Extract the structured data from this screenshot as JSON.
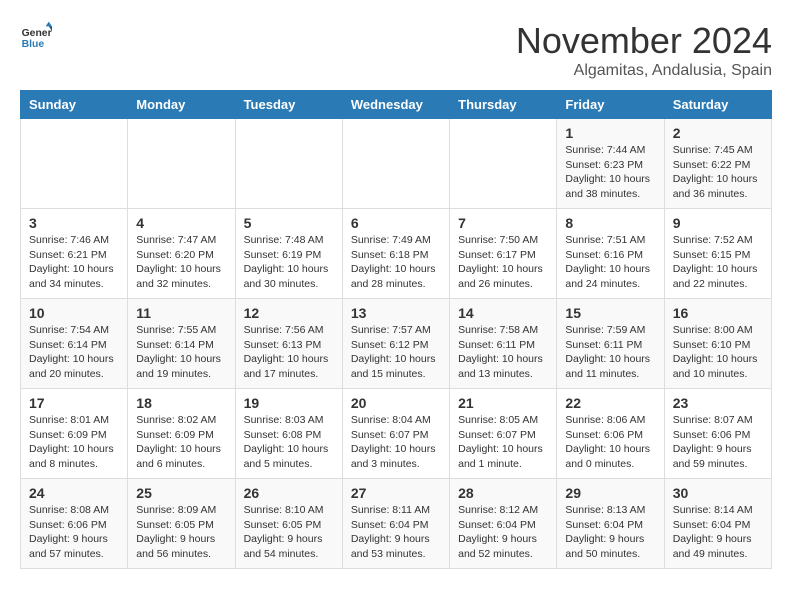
{
  "logo": {
    "line1": "General",
    "line2": "Blue"
  },
  "title": "November 2024",
  "subtitle": "Algamitas, Andalusia, Spain",
  "days_of_week": [
    "Sunday",
    "Monday",
    "Tuesday",
    "Wednesday",
    "Thursday",
    "Friday",
    "Saturday"
  ],
  "weeks": [
    [
      {
        "day": "",
        "info": ""
      },
      {
        "day": "",
        "info": ""
      },
      {
        "day": "",
        "info": ""
      },
      {
        "day": "",
        "info": ""
      },
      {
        "day": "",
        "info": ""
      },
      {
        "day": "1",
        "info": "Sunrise: 7:44 AM\nSunset: 6:23 PM\nDaylight: 10 hours and 38 minutes."
      },
      {
        "day": "2",
        "info": "Sunrise: 7:45 AM\nSunset: 6:22 PM\nDaylight: 10 hours and 36 minutes."
      }
    ],
    [
      {
        "day": "3",
        "info": "Sunrise: 7:46 AM\nSunset: 6:21 PM\nDaylight: 10 hours and 34 minutes."
      },
      {
        "day": "4",
        "info": "Sunrise: 7:47 AM\nSunset: 6:20 PM\nDaylight: 10 hours and 32 minutes."
      },
      {
        "day": "5",
        "info": "Sunrise: 7:48 AM\nSunset: 6:19 PM\nDaylight: 10 hours and 30 minutes."
      },
      {
        "day": "6",
        "info": "Sunrise: 7:49 AM\nSunset: 6:18 PM\nDaylight: 10 hours and 28 minutes."
      },
      {
        "day": "7",
        "info": "Sunrise: 7:50 AM\nSunset: 6:17 PM\nDaylight: 10 hours and 26 minutes."
      },
      {
        "day": "8",
        "info": "Sunrise: 7:51 AM\nSunset: 6:16 PM\nDaylight: 10 hours and 24 minutes."
      },
      {
        "day": "9",
        "info": "Sunrise: 7:52 AM\nSunset: 6:15 PM\nDaylight: 10 hours and 22 minutes."
      }
    ],
    [
      {
        "day": "10",
        "info": "Sunrise: 7:54 AM\nSunset: 6:14 PM\nDaylight: 10 hours and 20 minutes."
      },
      {
        "day": "11",
        "info": "Sunrise: 7:55 AM\nSunset: 6:14 PM\nDaylight: 10 hours and 19 minutes."
      },
      {
        "day": "12",
        "info": "Sunrise: 7:56 AM\nSunset: 6:13 PM\nDaylight: 10 hours and 17 minutes."
      },
      {
        "day": "13",
        "info": "Sunrise: 7:57 AM\nSunset: 6:12 PM\nDaylight: 10 hours and 15 minutes."
      },
      {
        "day": "14",
        "info": "Sunrise: 7:58 AM\nSunset: 6:11 PM\nDaylight: 10 hours and 13 minutes."
      },
      {
        "day": "15",
        "info": "Sunrise: 7:59 AM\nSunset: 6:11 PM\nDaylight: 10 hours and 11 minutes."
      },
      {
        "day": "16",
        "info": "Sunrise: 8:00 AM\nSunset: 6:10 PM\nDaylight: 10 hours and 10 minutes."
      }
    ],
    [
      {
        "day": "17",
        "info": "Sunrise: 8:01 AM\nSunset: 6:09 PM\nDaylight: 10 hours and 8 minutes."
      },
      {
        "day": "18",
        "info": "Sunrise: 8:02 AM\nSunset: 6:09 PM\nDaylight: 10 hours and 6 minutes."
      },
      {
        "day": "19",
        "info": "Sunrise: 8:03 AM\nSunset: 6:08 PM\nDaylight: 10 hours and 5 minutes."
      },
      {
        "day": "20",
        "info": "Sunrise: 8:04 AM\nSunset: 6:07 PM\nDaylight: 10 hours and 3 minutes."
      },
      {
        "day": "21",
        "info": "Sunrise: 8:05 AM\nSunset: 6:07 PM\nDaylight: 10 hours and 1 minute."
      },
      {
        "day": "22",
        "info": "Sunrise: 8:06 AM\nSunset: 6:06 PM\nDaylight: 10 hours and 0 minutes."
      },
      {
        "day": "23",
        "info": "Sunrise: 8:07 AM\nSunset: 6:06 PM\nDaylight: 9 hours and 59 minutes."
      }
    ],
    [
      {
        "day": "24",
        "info": "Sunrise: 8:08 AM\nSunset: 6:06 PM\nDaylight: 9 hours and 57 minutes."
      },
      {
        "day": "25",
        "info": "Sunrise: 8:09 AM\nSunset: 6:05 PM\nDaylight: 9 hours and 56 minutes."
      },
      {
        "day": "26",
        "info": "Sunrise: 8:10 AM\nSunset: 6:05 PM\nDaylight: 9 hours and 54 minutes."
      },
      {
        "day": "27",
        "info": "Sunrise: 8:11 AM\nSunset: 6:04 PM\nDaylight: 9 hours and 53 minutes."
      },
      {
        "day": "28",
        "info": "Sunrise: 8:12 AM\nSunset: 6:04 PM\nDaylight: 9 hours and 52 minutes."
      },
      {
        "day": "29",
        "info": "Sunrise: 8:13 AM\nSunset: 6:04 PM\nDaylight: 9 hours and 50 minutes."
      },
      {
        "day": "30",
        "info": "Sunrise: 8:14 AM\nSunset: 6:04 PM\nDaylight: 9 hours and 49 minutes."
      }
    ]
  ]
}
